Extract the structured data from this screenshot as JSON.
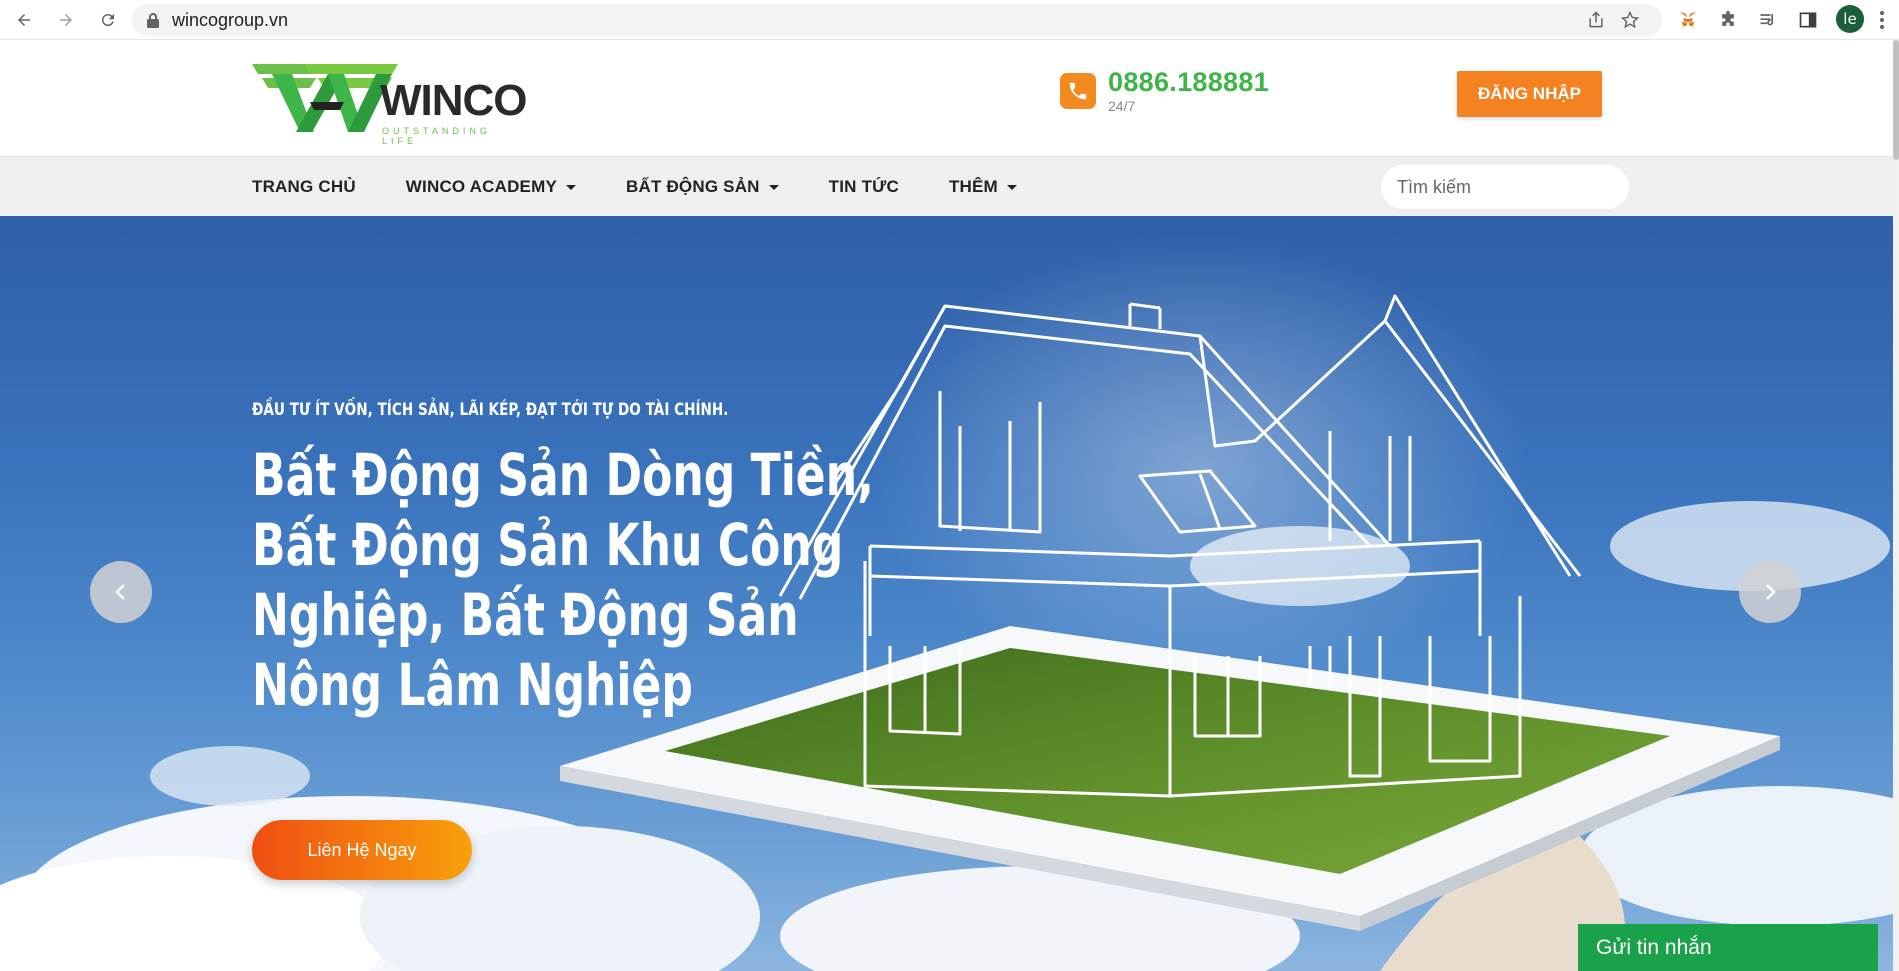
{
  "browser": {
    "url": "wincogroup.vn",
    "profile_initial": "le"
  },
  "header": {
    "logo_text": "WINCO",
    "logo_tagline": "OUTSTANDING LIFE",
    "phone": "0886.188881",
    "phone_sub": "24/7",
    "login_label": "ĐĂNG NHẬP"
  },
  "nav": {
    "items": [
      {
        "label": "TRANG CHỦ",
        "dropdown": false
      },
      {
        "label": "WINCO ACADEMY",
        "dropdown": true
      },
      {
        "label": "BẤT ĐỘNG SẢN",
        "dropdown": true
      },
      {
        "label": "TIN TỨC",
        "dropdown": false
      },
      {
        "label": "THÊM",
        "dropdown": true
      }
    ],
    "search_placeholder": "Tìm kiếm"
  },
  "hero": {
    "tagline": "ĐẦU TƯ ÍT VỐN, TÍCH SẢN, LÃI KÉP, ĐẠT TỚI TỰ DO TÀI CHÍNH.",
    "headline_lines": [
      "Bất Động Sản Dòng Tiền,",
      "Bất Động Sản Khu Công",
      "Nghiệp, Bất Động Sản",
      "Nông Lâm Nghiệp"
    ],
    "cta_label": "Liên Hệ Ngay"
  },
  "chat": {
    "label": "Gửi tin nhắn"
  },
  "colors": {
    "brand_green": "#3eb548",
    "accent_orange": "#f58220",
    "chat_green": "#1aa24a"
  }
}
